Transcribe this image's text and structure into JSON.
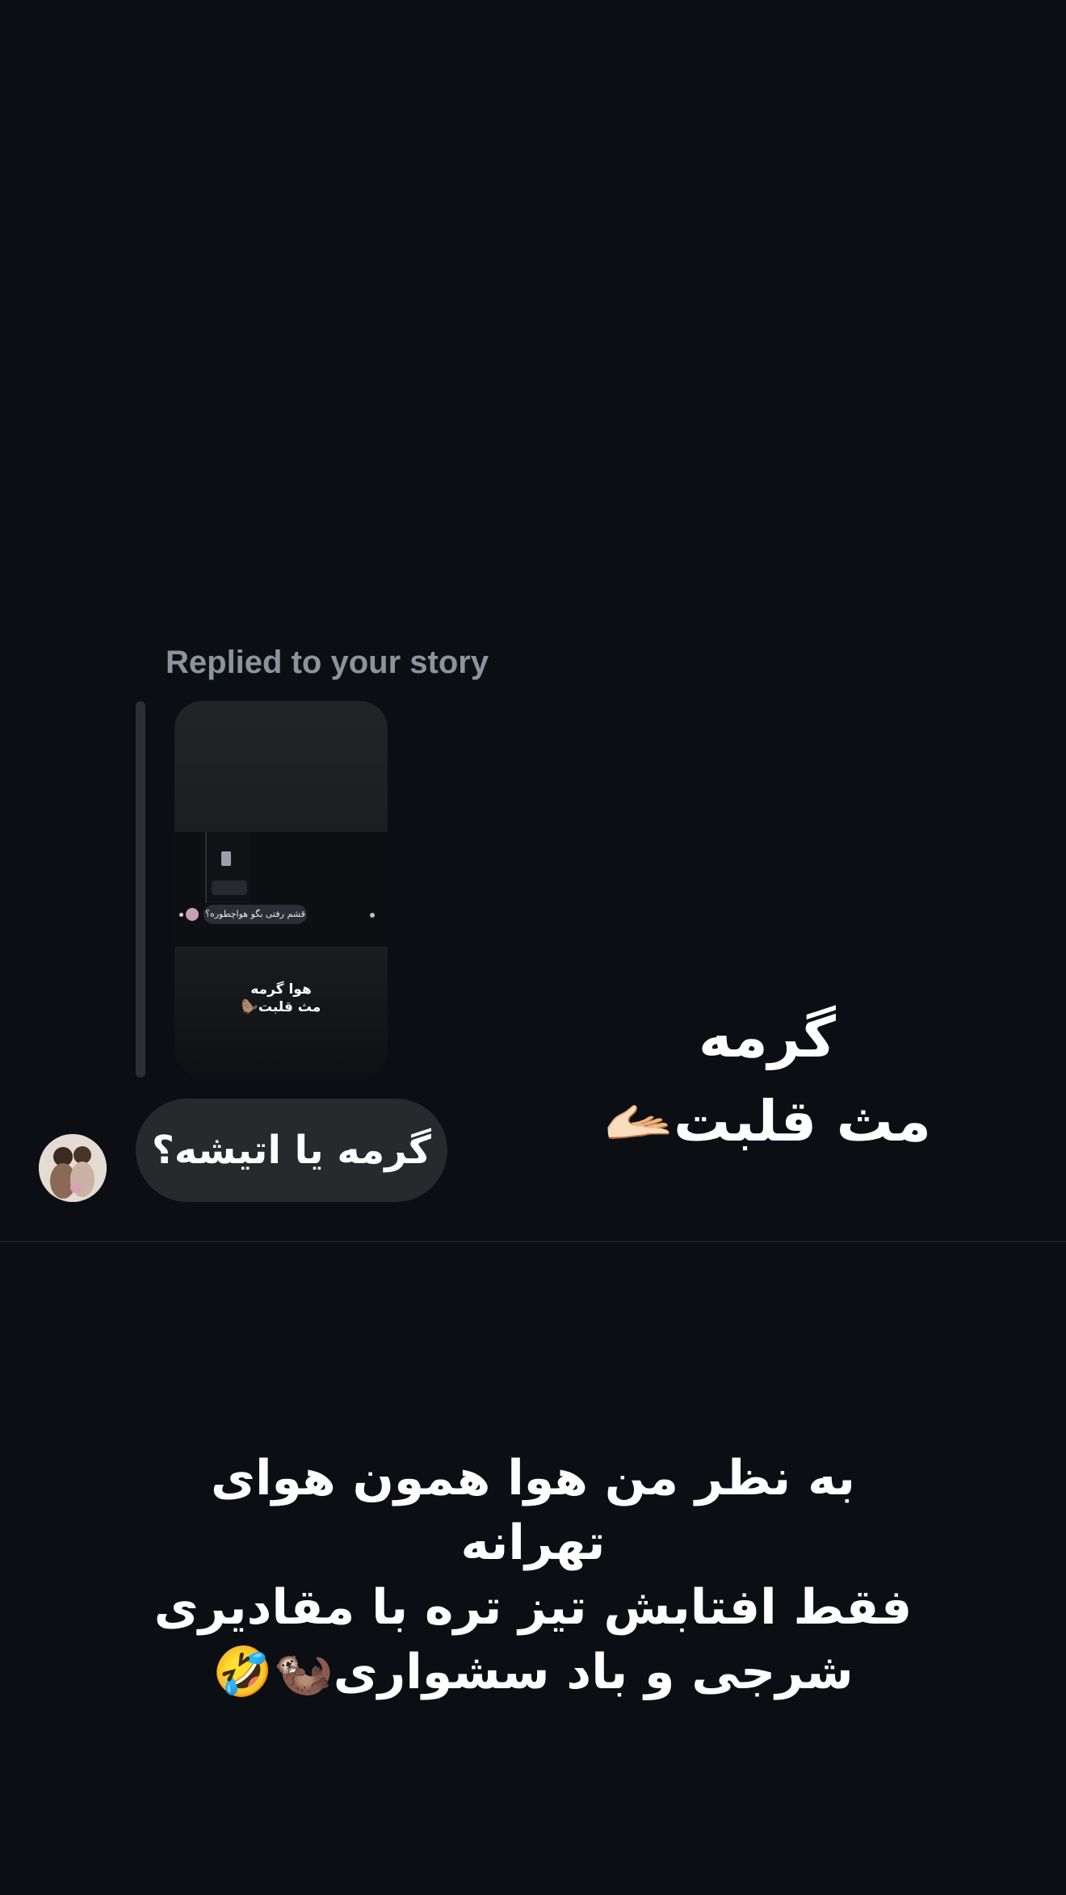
{
  "reply_header": {
    "label": "Replied to your story"
  },
  "story_preview": {
    "question_text": "قشم رفتی بگو هواچطوره؟",
    "caption_line1": "هوا گرمه",
    "caption_line2": "مث قلبت🦫"
  },
  "story_caption": {
    "line1": "گرمه",
    "line2": "مث قلبت🫴🏻"
  },
  "message": {
    "text": "گرمه یا اتیشه؟"
  },
  "bottom_post": {
    "line1": "به نظر من هوا همون هوای",
    "line2": "تهرانه",
    "line3": "فقط افتابش تیز تره با مقادیری",
    "line4": "شرجی و باد سشواری🦦🤣"
  },
  "colors": {
    "background": "#0b0e13",
    "bubble": "#27292d",
    "muted_text": "#8e939b"
  }
}
